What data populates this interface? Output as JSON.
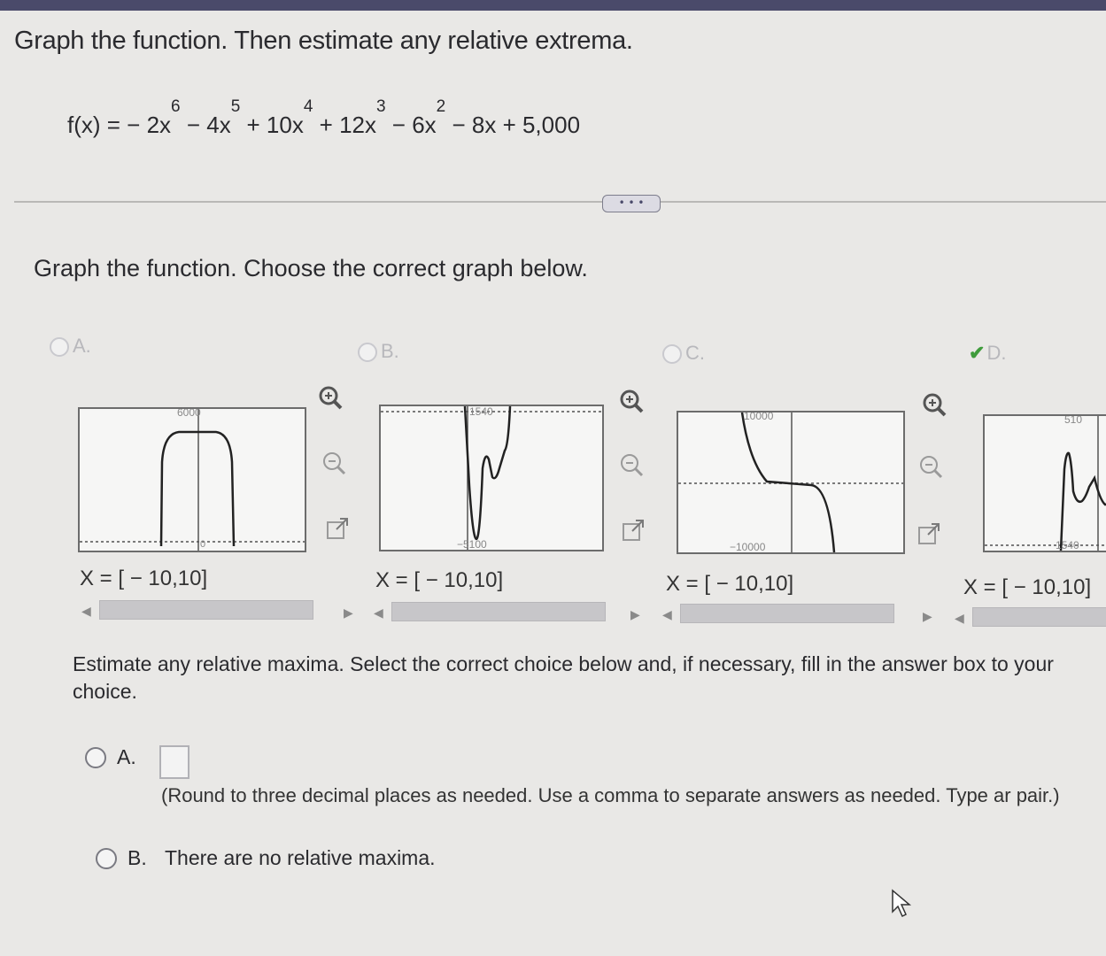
{
  "question": {
    "title": "Graph the function. Then estimate any relative extrema.",
    "formula_parts": {
      "lhs": "f(x) = − 2x",
      "e6": "6",
      "t2": " − 4x",
      "e5": "5",
      "t3": " + 10x",
      "e4": "4",
      "t4": " + 12x",
      "e3": "3",
      "t5": " − 6x",
      "e2": "2",
      "t6": " − 8x + 5,000"
    },
    "more_button": "• • •"
  },
  "part1": {
    "prompt": "Graph the function. Choose the correct graph below.",
    "options": [
      {
        "letter": "A.",
        "top_label": "6000",
        "bottom_label": "0",
        "xrange": "X = [ − 10,10]"
      },
      {
        "letter": "B.",
        "top_label": "1540",
        "bottom_label": "−5100",
        "xrange": "X = [ − 10,10]"
      },
      {
        "letter": "C.",
        "top_label": "10000",
        "bottom_label": "−10000",
        "xrange": "X = [ − 10,10]"
      },
      {
        "letter": "D.",
        "top_label": "510",
        "bottom_label": "1540",
        "xrange": "X = [ − 10,10]",
        "selected": true
      }
    ],
    "tool_icons": [
      "zoom-in-icon",
      "zoom-out-icon",
      "expand-icon"
    ]
  },
  "part2": {
    "prompt": "Estimate any relative maxima. Select the correct choice below and, if necessary, fill in the answer box to your choice.",
    "choice_a_letter": "A.",
    "choice_a_hint": "(Round to three decimal places as needed. Use a comma to separate answers as needed. Type ar pair.)",
    "choice_b_letter": "B.",
    "choice_b_text": "There are no relative maxima."
  },
  "colors": {
    "accent_check": "#3f9c3c",
    "topbar": "#4a4a6a"
  }
}
